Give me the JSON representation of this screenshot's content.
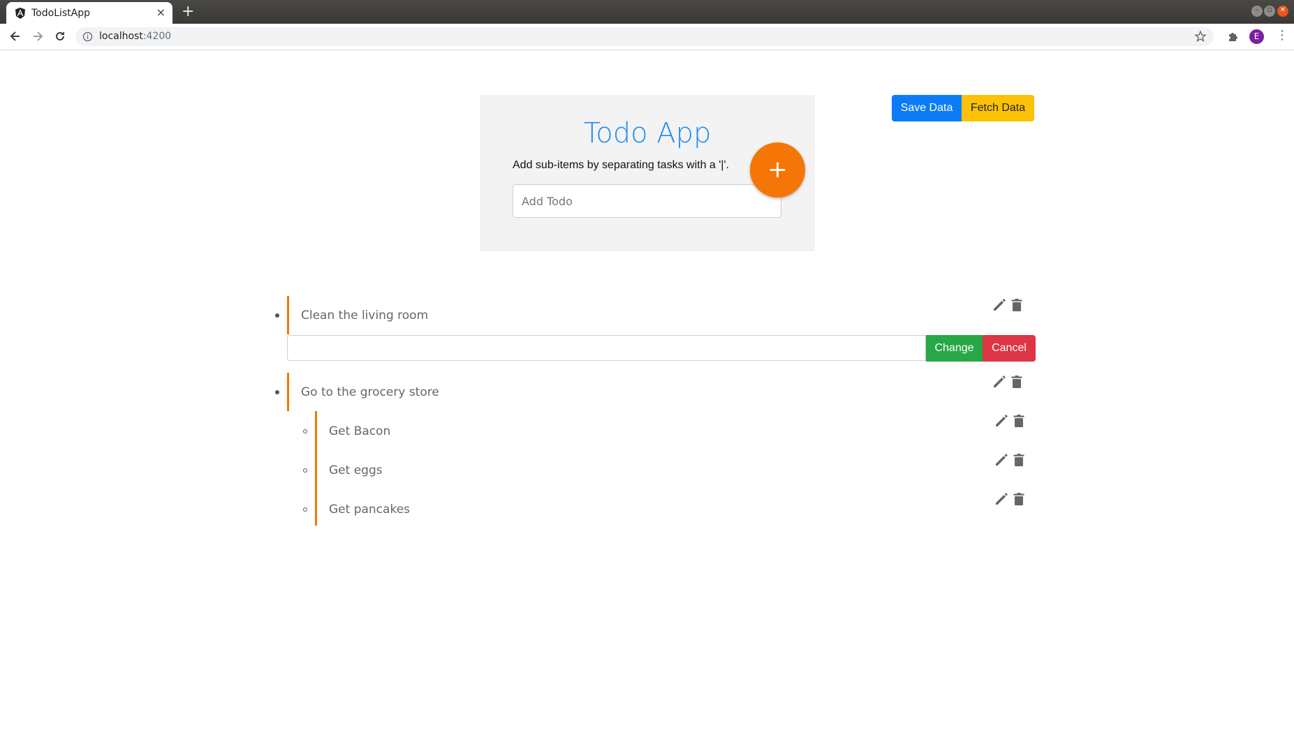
{
  "browser": {
    "tab_title": "TodoListApp",
    "tab_close": "×",
    "new_tab": "+",
    "url_host": "localhost",
    "url_port": ":4200",
    "profile_initial": "E",
    "menu": "⋮",
    "win_min": "–",
    "win_max": "▫",
    "win_close": "✕"
  },
  "app": {
    "title": "Todo App",
    "hint": "Add sub-items by separating tasks with a '|'.",
    "add_placeholder": "Add Todo",
    "add_button": "+",
    "save_button": "Save Data",
    "fetch_button": "Fetch Data"
  },
  "todos": [
    {
      "text": "Clean the living room",
      "editing": true,
      "edit_value": "",
      "change_label": "Change",
      "cancel_label": "Cancel"
    },
    {
      "text": "Go to the grocery store",
      "sub_items": [
        "Get Bacon",
        "Get eggs",
        "Get pancakes"
      ]
    }
  ],
  "icons": {
    "edit": "pencil-icon",
    "delete": "trash-icon"
  },
  "colors": {
    "accent": "#f57606",
    "title_blue": "#1f8bf0",
    "save_blue": "#0b7cf5",
    "fetch_yellow": "#fdc107",
    "change_green": "#27a745",
    "cancel_red": "#dc3545",
    "icon_gray": "#666666"
  }
}
